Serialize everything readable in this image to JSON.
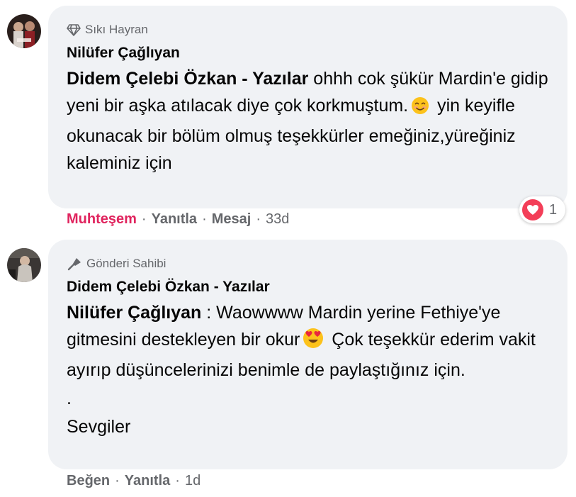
{
  "comment1": {
    "badge": "Sıkı Hayran",
    "author": "Nilüfer Çağlıyan",
    "mention": "Didem Çelebi Özkan - Yazılar",
    "text_part1": " ohhh cok şükür Mardin'e gidip yeni bir aşka atılacak diye çok korkmuştum.",
    "text_part2": " yin keyifle okunacak bir bölüm olmuş teşekkürler emeğiniz,yüreğiniz kaleminiz için",
    "reaction_label": "Muhteşem",
    "reply_label": "Yanıtla",
    "message_label": "Mesaj",
    "time": "33d",
    "reaction_count": "1",
    "sep": "·"
  },
  "comment2": {
    "badge": "Gönderi Sahibi",
    "author": "Didem Çelebi Özkan - Yazılar",
    "mention": "Nilüfer Çağlıyan",
    "text_part1": " : Waowwww Mardin yerine Fethiye'ye gitmesini destekleyen bir okur",
    "text_part2": " Çok teşekkür ederim vakit ayırıp düşüncelerinizi benimle de paylaştığınız için.",
    "dot_line": ".",
    "sign_off": "Sevgiler",
    "like_label": "Beğen",
    "reply_label": "Yanıtla",
    "time": "1d",
    "sep": "·"
  }
}
